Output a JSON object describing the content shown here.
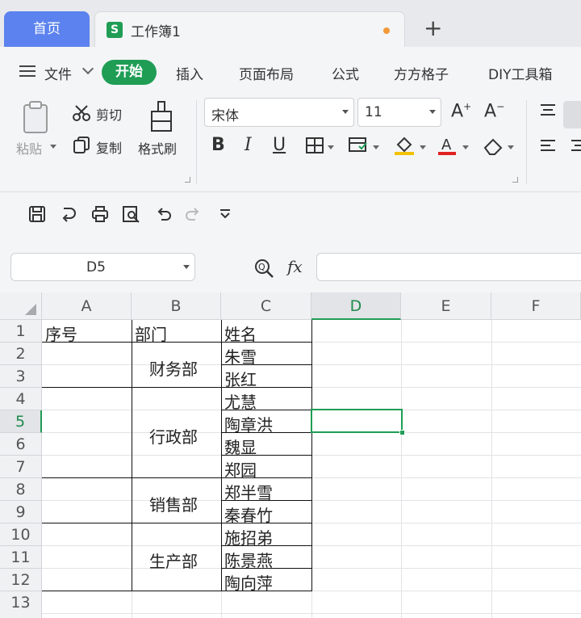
{
  "tabs": {
    "home": "首页",
    "doc_icon": "S",
    "doc_title": "工作簿1",
    "add": "+"
  },
  "menu": {
    "file": "文件",
    "start": "开始",
    "insert": "插入",
    "page_layout": "页面布局",
    "formula": "公式",
    "fangfang": "方方格子",
    "diy": "DIY工具箱"
  },
  "ribbon": {
    "paste": "粘贴",
    "cut": "剪切",
    "copy": "复制",
    "format_painter": "格式刷",
    "font_name": "宋体",
    "font_size": "11",
    "bold": "B",
    "italic": "I",
    "underline": "U",
    "increase_font": "A",
    "decrease_font": "A"
  },
  "formula_bar": {
    "name_box": "D5",
    "fx": "fx",
    "formula": ""
  },
  "sheet": {
    "columns": [
      "A",
      "B",
      "C",
      "D",
      "E",
      "F"
    ],
    "rows": [
      "1",
      "2",
      "3",
      "4",
      "5",
      "6",
      "7",
      "8",
      "9",
      "10",
      "11",
      "12",
      "13"
    ],
    "active_cell": "D5",
    "header": {
      "a": "序号",
      "b": "部门",
      "c": "姓名"
    },
    "departments": [
      "财务部",
      "行政部",
      "销售部",
      "生产部"
    ],
    "names": [
      "朱雪",
      "张红",
      "尤慧",
      "陶章洪",
      "魏显",
      "郑园",
      "郑半雪",
      "秦春竹",
      "施招弟",
      "陈景燕",
      "陶向萍"
    ]
  },
  "colors": {
    "accent": "#1f9d55",
    "home_tab": "#5b82ee",
    "modified_dot": "#f29a38"
  }
}
